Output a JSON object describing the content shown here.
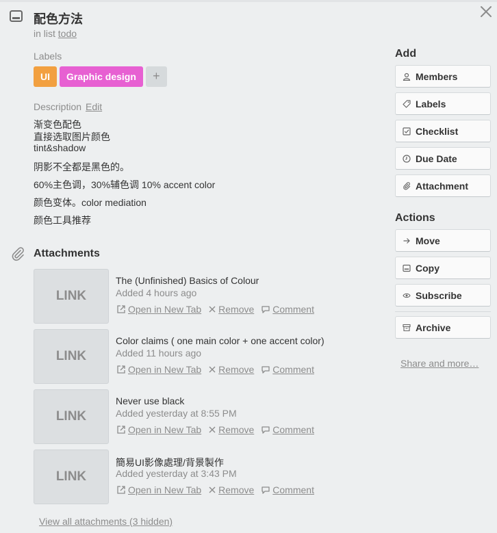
{
  "card": {
    "title": "配色方法",
    "in_list_prefix": "in list",
    "list_name": "todo"
  },
  "labels": {
    "heading": "Labels",
    "items": [
      {
        "text": "UI",
        "color": "#f2a040"
      },
      {
        "text": "Graphic design",
        "color": "#e760d2"
      }
    ],
    "add_symbol": "+"
  },
  "description": {
    "heading": "Description",
    "edit": "Edit",
    "lines": [
      "渐变色配色",
      "直接选取图片颜色",
      "tint&shadow",
      "阴影不全都是黑色的。",
      "60%主色调，30%辅色调 10% accent color",
      "颜色变体。color mediation",
      "颜色工具推荐"
    ]
  },
  "attachments": {
    "heading": "Attachments",
    "thumb_label": "LINK",
    "action_labels": {
      "open": "Open in New Tab",
      "remove": "Remove",
      "comment": "Comment"
    },
    "items": [
      {
        "title": "The (Unfinished) Basics of Colour",
        "added": "Added 4 hours ago"
      },
      {
        "title": "Color claims ( one main color + one accent color)",
        "added": "Added 11 hours ago"
      },
      {
        "title": "Never use black",
        "added": "Added yesterday at 8:55 PM"
      },
      {
        "title": "簡易UI影像處理/背景製作",
        "added": "Added yesterday at 3:43 PM"
      }
    ],
    "view_all": "View all attachments (3 hidden)"
  },
  "sidebar": {
    "add_heading": "Add",
    "add_buttons": [
      {
        "label": "Members",
        "icon": "person-icon"
      },
      {
        "label": "Labels",
        "icon": "tag-icon"
      },
      {
        "label": "Checklist",
        "icon": "checkbox-icon"
      },
      {
        "label": "Due Date",
        "icon": "clock-icon"
      },
      {
        "label": "Attachment",
        "icon": "paperclip-icon"
      }
    ],
    "actions_heading": "Actions",
    "action_buttons": [
      {
        "label": "Move",
        "icon": "arrow-right-icon"
      },
      {
        "label": "Copy",
        "icon": "card-icon"
      },
      {
        "label": "Subscribe",
        "icon": "eye-icon"
      }
    ],
    "archive": {
      "label": "Archive",
      "icon": "archive-icon"
    },
    "share_more": "Share and more…"
  },
  "colors": {
    "background": "#edeff0",
    "label_ui": "#f2a040",
    "label_graphic": "#e760d2",
    "muted_text": "#8c8c8c"
  }
}
